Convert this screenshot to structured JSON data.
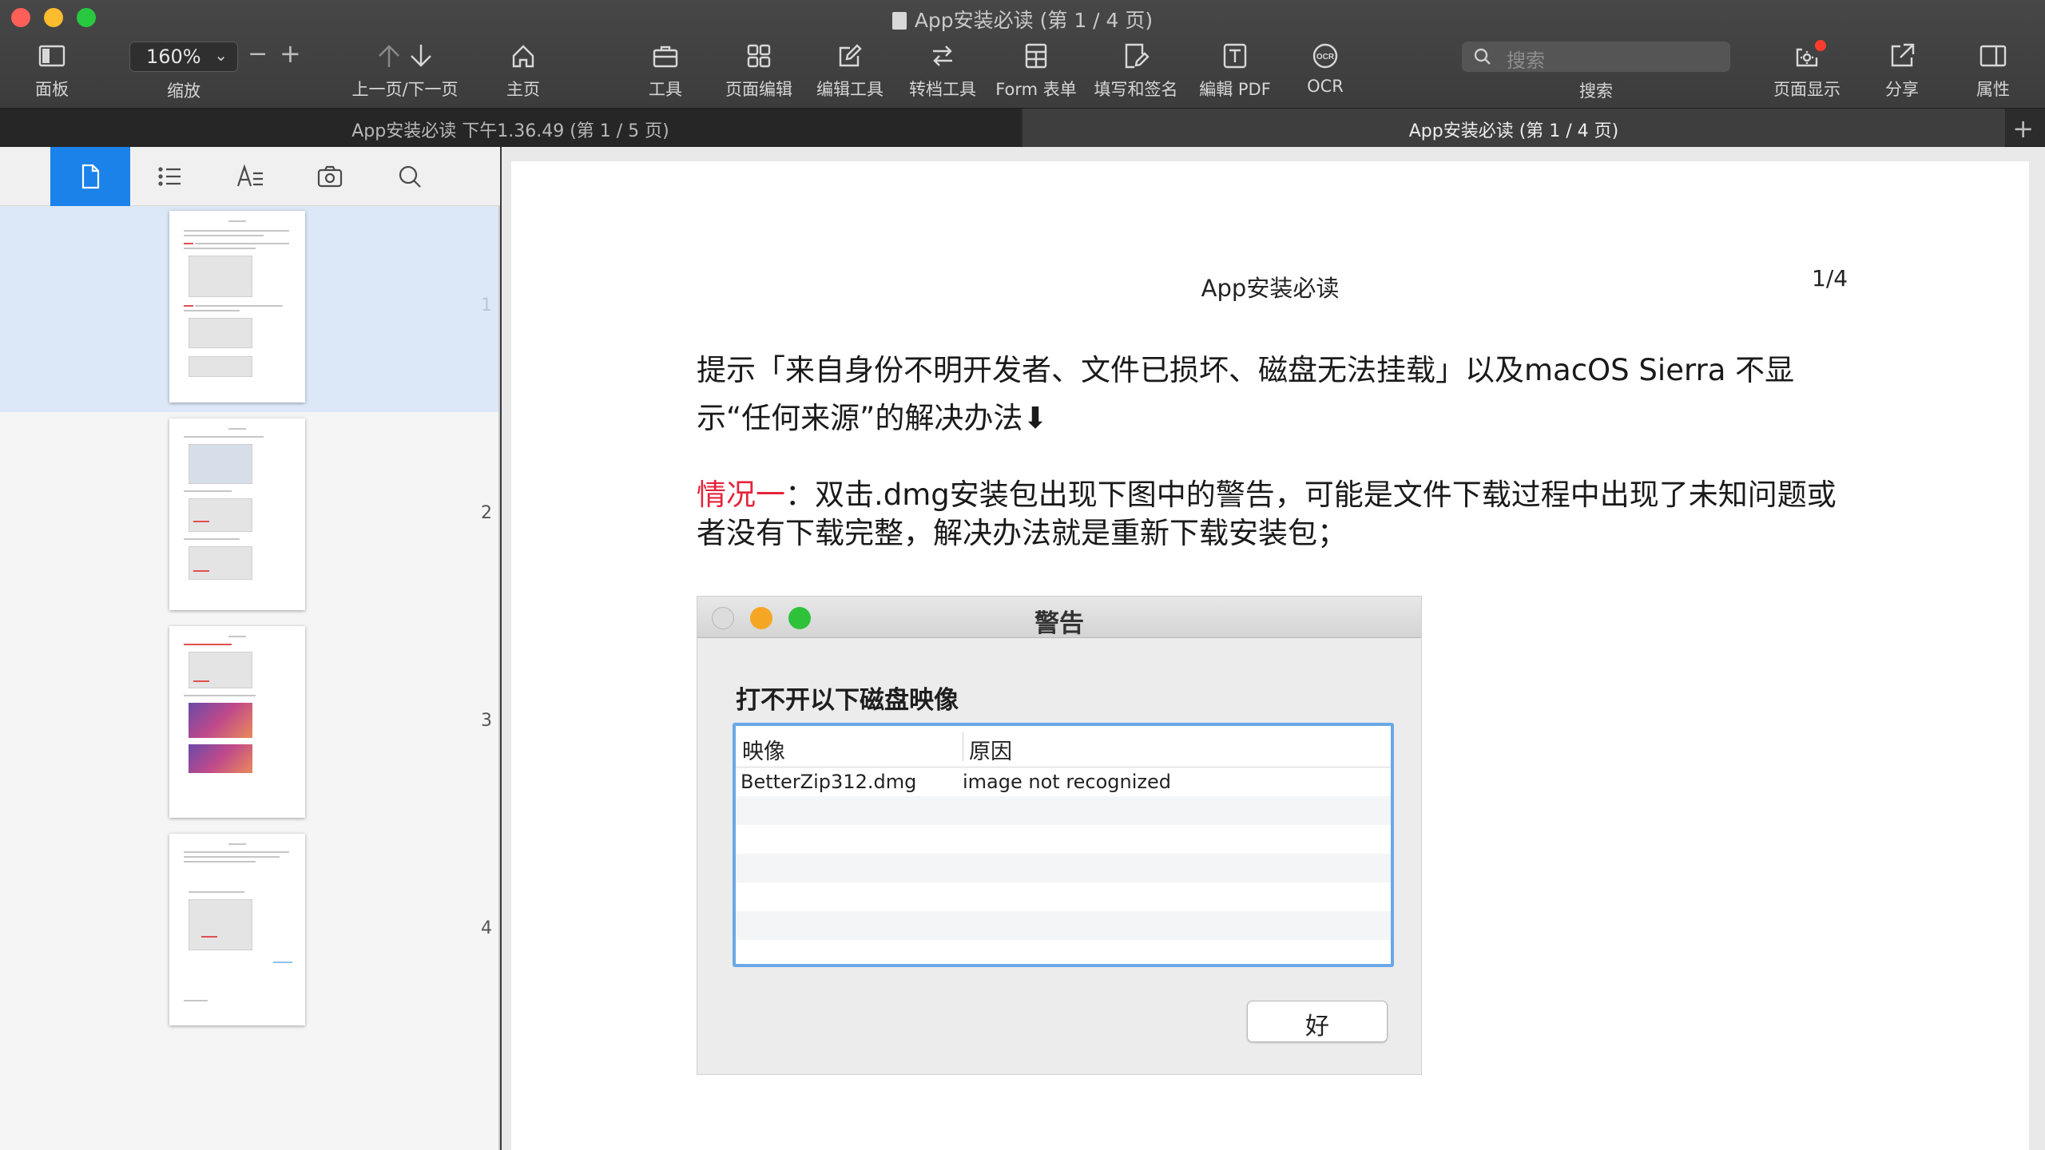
{
  "window": {
    "title": "App安装必读 (第 1 / 4 页)"
  },
  "toolbar": {
    "panel": "面板",
    "zoom_value": "160%",
    "zoom_label": "缩放",
    "zoom_minus": "−",
    "zoom_plus": "+",
    "prev_next": "上一页/下一页",
    "home": "主页",
    "tools": "工具",
    "page_edit": "页面编辑",
    "edit_tools": "编辑工具",
    "convert": "转档工具",
    "form": "Form 表单",
    "fill_sign": "填写和签名",
    "edit_pdf": "編輯 PDF",
    "ocr": "OCR",
    "search_placeholder": "搜索",
    "search_label": "搜索",
    "page_display": "页面显示",
    "share": "分享",
    "properties": "属性"
  },
  "tabs": [
    {
      "label": "App安装必读 下午1.36.49 (第 1 / 5 页)"
    },
    {
      "label": "App安装必读 (第 1 / 4 页)"
    }
  ],
  "tab_add": "+",
  "sidebar": {
    "pages": [
      "1",
      "2",
      "3",
      "4"
    ]
  },
  "document": {
    "header": "App安装必读",
    "page_number": "1/4",
    "para1": "提示「来自身份不明开发者、文件已损坏、磁盘无法挂载」以及macOS Sierra 不显示“任何来源”的解决办法⬇",
    "para2_highlight": "情况一",
    "para2_rest": "：双击.dmg安装包出现下图中的警告，可能是文件下载过程中出现了未知问题或者没有下载完整，解决办法就是重新下载安装包；"
  },
  "alert": {
    "title": "警告",
    "heading": "打不开以下磁盘映像",
    "columns": [
      "映像",
      "原因"
    ],
    "rows": [
      [
        "BetterZip312.dmg",
        "image not recognized"
      ]
    ],
    "ok_label": "好"
  },
  "colors": {
    "accent": "#1b82ea",
    "highlight_red": "#e5243b",
    "table_border": "#6aa8e6"
  }
}
